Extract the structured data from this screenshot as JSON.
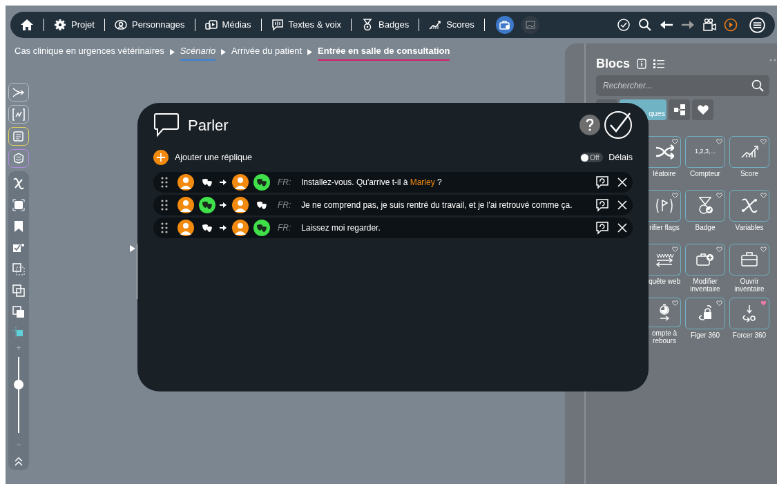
{
  "top_bar": {
    "items": [
      {
        "label": "Projet"
      },
      {
        "label": "Personnages"
      },
      {
        "label": "Médias"
      },
      {
        "label": "Textes & voix"
      },
      {
        "label": "Badges"
      },
      {
        "label": "Scores"
      }
    ],
    "view_buttons": [
      {
        "selected": true
      },
      {
        "selected": false
      }
    ]
  },
  "breadcrumb": [
    {
      "label": "Cas clinique en urgences vétérinaires",
      "kind": "plain"
    },
    {
      "label": "Scénario",
      "kind": "italic",
      "color": "#3b82d6"
    },
    {
      "label": "Arrivée du patient",
      "kind": "plain"
    },
    {
      "label": "Entrée en salle de consultation",
      "kind": "bold",
      "color": "#d61f69"
    }
  ],
  "left_toolbar": {
    "framed_buttons": [
      {
        "color": "#b8bec4"
      },
      {
        "color": "#b8bec4"
      },
      {
        "color": "#e6d35a"
      },
      {
        "color": "#b48be0"
      }
    ],
    "zoom_plus": "+",
    "zoom_minus": "−",
    "zoom": {
      "level": 0.64
    }
  },
  "dialog": {
    "title": "Parler",
    "add_label": "Ajouter une réplique",
    "delays": {
      "on": false,
      "state_label": "Off",
      "label": "Délais"
    },
    "lines": [
      {
        "from_emotion_active": false,
        "to_emotion_active": true,
        "lang": "FR:",
        "segments": [
          {
            "text": "Installez-vous. Qu'arrive t-il à ",
            "highlight": false
          },
          {
            "text": "Marley",
            "highlight": true
          },
          {
            "text": " ?",
            "highlight": false
          }
        ]
      },
      {
        "from_emotion_active": true,
        "to_emotion_active": false,
        "lang": "FR:",
        "segments": [
          {
            "text": "Je ne comprend pas, je suis rentré du travail, et je l'ai retrouvé comme ça.",
            "highlight": false
          }
        ]
      },
      {
        "from_emotion_active": false,
        "to_emotion_active": true,
        "lang": "FR:",
        "segments": [
          {
            "text": "Laissez moi regarder.",
            "highlight": false
          }
        ]
      }
    ]
  },
  "blocks_panel": {
    "title": "Blocs",
    "search": {
      "placeholder": "Rechercher..."
    },
    "tabs": [
      {
        "selected": false
      },
      {
        "label": "ques",
        "selected": true
      },
      {
        "selected": false
      },
      {
        "selected": false
      }
    ],
    "blocks": [
      {
        "label": "léatoire",
        "favorite": false
      },
      {
        "label": "Compteur",
        "favorite": false,
        "tile_text": "1,2,3,..."
      },
      {
        "label": "Score",
        "favorite": false
      },
      {
        "label": "rifier flags",
        "favorite": false
      },
      {
        "label": "Badge",
        "favorite": false
      },
      {
        "label": "Variables",
        "favorite": false
      },
      {
        "label": "quête web",
        "favorite": false
      },
      {
        "label": "Modifier inventaire",
        "favorite": false
      },
      {
        "label": "Ouvrir inventaire",
        "favorite": false
      },
      {
        "label": "ompte à rebours",
        "favorite": false
      },
      {
        "label": "Figer 360",
        "favorite": false
      },
      {
        "label": "Forcer 360",
        "favorite": true
      }
    ]
  }
}
